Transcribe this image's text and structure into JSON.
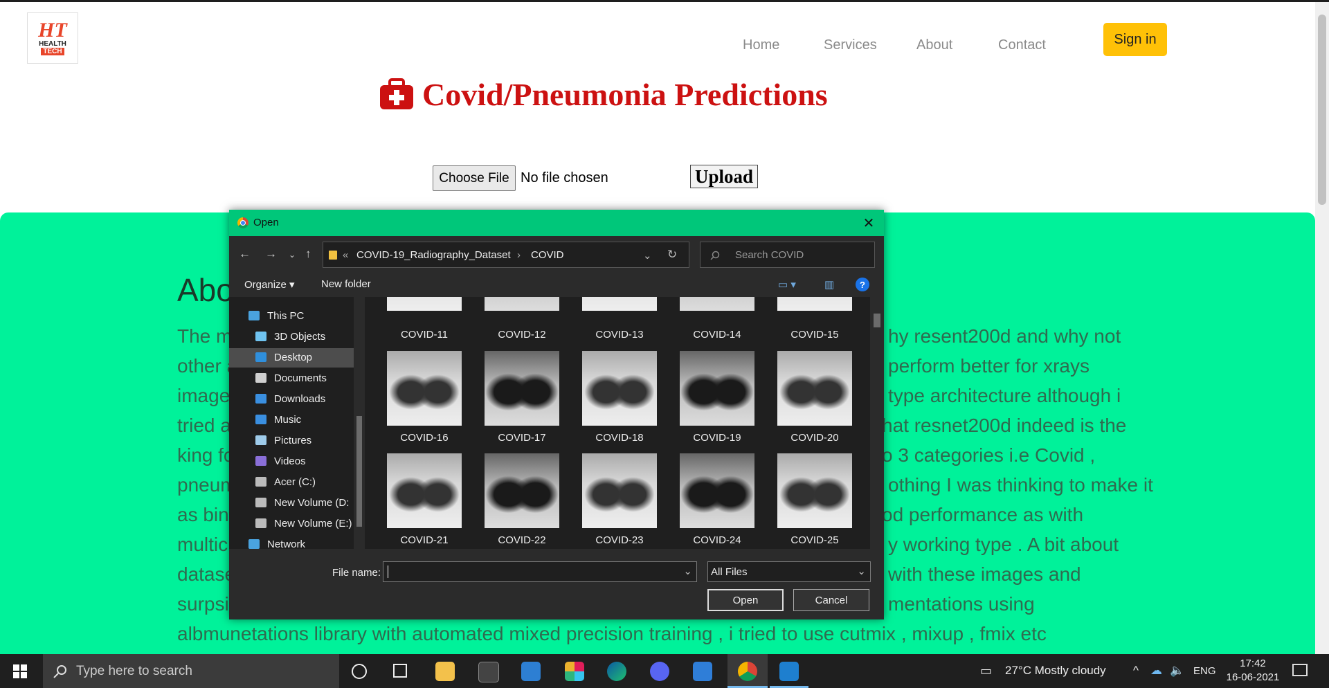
{
  "site": {
    "logo": {
      "mark": "HT",
      "line1": "HEALTH",
      "line2": "TECH"
    },
    "nav": [
      "Home",
      "Services",
      "About",
      "Contact"
    ],
    "signin": "Sign in",
    "heading": "Covid/Pneumonia Predictions",
    "choose_file": "Choose File",
    "no_file": "No file chosen",
    "upload": "Upload",
    "about_heading": "Abo",
    "paragraph_lines": [
      {
        "left": "The m",
        "right": "hy resent200d and why not"
      },
      {
        "left": "other a",
        "right": "perform better for xrays"
      },
      {
        "left": "image",
        "right": "type architecture although i"
      },
      {
        "left": "tried a",
        "right": "hat resnet200d indeed is the"
      },
      {
        "left": "king fo",
        "right": "o 3 categories i.e Covid ,"
      },
      {
        "left": "pneum",
        "right": "othing I was thinking to make it"
      },
      {
        "left": "as bina",
        "right": "od performance as with"
      },
      {
        "left": "multicl",
        "right": "y working type . A bit about"
      },
      {
        "left": "datase",
        "right": "with these images and"
      },
      {
        "left": "surpsir",
        "right": "mentations using"
      },
      {
        "left": "albmunetations library with automated mixed precision training , i tried to use cutmix , mixup , fmix etc",
        "right": ""
      }
    ]
  },
  "dialog": {
    "title": "Open",
    "path": [
      "COVID-19_Radiography_Dataset",
      "COVID"
    ],
    "search_placeholder": "Search COVID",
    "organize": "Organize ▾",
    "new_folder": "New folder",
    "help": "?",
    "tree": [
      {
        "label": "This PC",
        "icon": "pc-icon",
        "color": "#4aa3df",
        "indent": 0
      },
      {
        "label": "3D Objects",
        "icon": "cube-icon",
        "color": "#6fc3f0",
        "indent": 1
      },
      {
        "label": "Desktop",
        "icon": "desktop-icon",
        "color": "#2f8fdc",
        "indent": 1,
        "selected": true
      },
      {
        "label": "Documents",
        "icon": "document-icon",
        "color": "#cfcfcf",
        "indent": 1
      },
      {
        "label": "Downloads",
        "icon": "download-icon",
        "color": "#3a8fe0",
        "indent": 1
      },
      {
        "label": "Music",
        "icon": "music-icon",
        "color": "#3a8fe0",
        "indent": 1
      },
      {
        "label": "Pictures",
        "icon": "pictures-icon",
        "color": "#9ecbea",
        "indent": 1
      },
      {
        "label": "Videos",
        "icon": "video-icon",
        "color": "#8a6fd8",
        "indent": 1
      },
      {
        "label": "Acer (C:)",
        "icon": "drive-icon",
        "color": "#bbbbbb",
        "indent": 1
      },
      {
        "label": "New Volume (D:",
        "icon": "drive-icon",
        "color": "#bbbbbb",
        "indent": 1
      },
      {
        "label": "New Volume (E:)",
        "icon": "drive-icon",
        "color": "#bbbbbb",
        "indent": 1
      },
      {
        "label": "Network",
        "icon": "network-icon",
        "color": "#4aa3df",
        "indent": 0
      }
    ],
    "files_top_row": [
      "COVID-11",
      "COVID-12",
      "COVID-13",
      "COVID-14",
      "COVID-15"
    ],
    "files_mid_row": [
      "COVID-16",
      "COVID-17",
      "COVID-18",
      "COVID-19",
      "COVID-20"
    ],
    "files_bottom_row": [
      "COVID-21",
      "COVID-22",
      "COVID-23",
      "COVID-24",
      "COVID-25"
    ],
    "file_name_label": "File name:",
    "file_name_value": "",
    "file_type": "All Files",
    "open": "Open",
    "cancel": "Cancel"
  },
  "taskbar": {
    "search_placeholder": "Type here to search",
    "weather": "27°C  Mostly cloudy",
    "lang": "ENG",
    "time": "17:42",
    "date": "16-06-2021"
  },
  "colors": {
    "accent_green": "#00f29a",
    "heading_red": "#cc1111",
    "signin_yellow": "#ffc107",
    "dialog_title": "#00c77a"
  }
}
